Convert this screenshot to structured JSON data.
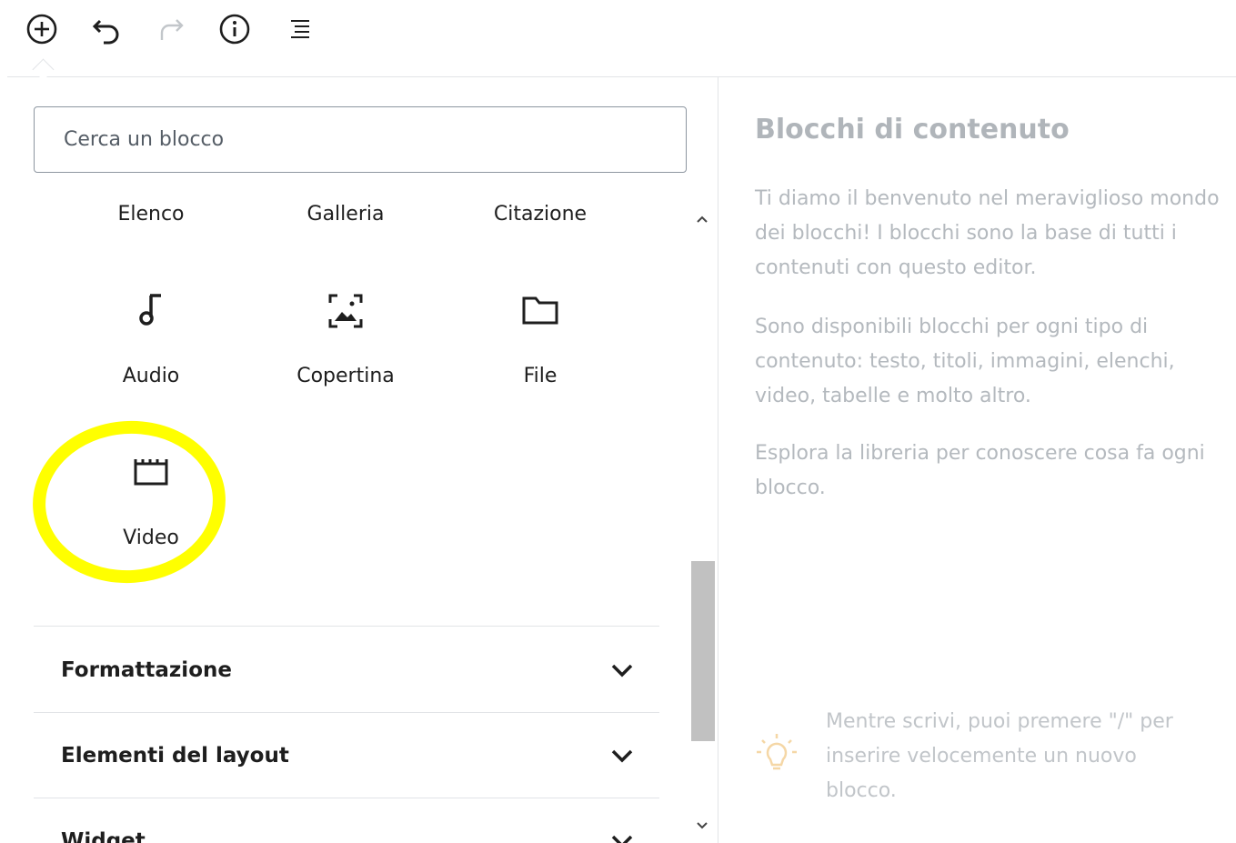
{
  "toolbar": {
    "buttons": [
      {
        "name": "add-block-button",
        "icon": "plus-circle-icon"
      },
      {
        "name": "undo-button",
        "icon": "undo-icon"
      },
      {
        "name": "redo-button",
        "icon": "redo-icon"
      },
      {
        "name": "info-button",
        "icon": "info-icon"
      },
      {
        "name": "outline-button",
        "icon": "list-outline-icon"
      }
    ]
  },
  "inserter": {
    "search_placeholder": "Cerca un blocco",
    "blocks_top_row": [
      "Elenco",
      "Galleria",
      "Citazione"
    ],
    "blocks": [
      {
        "label": "Audio",
        "icon": "music-note-icon"
      },
      {
        "label": "Copertina",
        "icon": "cover-image-icon"
      },
      {
        "label": "File",
        "icon": "folder-icon"
      },
      {
        "label": "Video",
        "icon": "video-icon"
      }
    ],
    "sections": [
      {
        "title": "Formattazione"
      },
      {
        "title": "Elementi del layout"
      },
      {
        "title": "Widget"
      }
    ],
    "highlight_color": "#ffff00"
  },
  "help_panel": {
    "title": "Blocchi di contenuto",
    "paragraphs": [
      "Ti diamo il benvenuto nel meraviglioso mondo dei blocchi! I blocchi sono la base di tutti i contenuti con questo editor.",
      "Sono disponibili blocchi per ogni tipo di contenuto: testo, titoli, immagini, elenchi, video, tabelle e molto altro.",
      "Esplora la libreria per conoscere cosa fa ogni blocco."
    ],
    "tip": "Mentre scrivi, puoi premere \"/\" per inserire velocemente un nuovo blocco.",
    "tip_icon": "lightbulb-icon",
    "tip_icon_color": "#f5d7a6"
  }
}
